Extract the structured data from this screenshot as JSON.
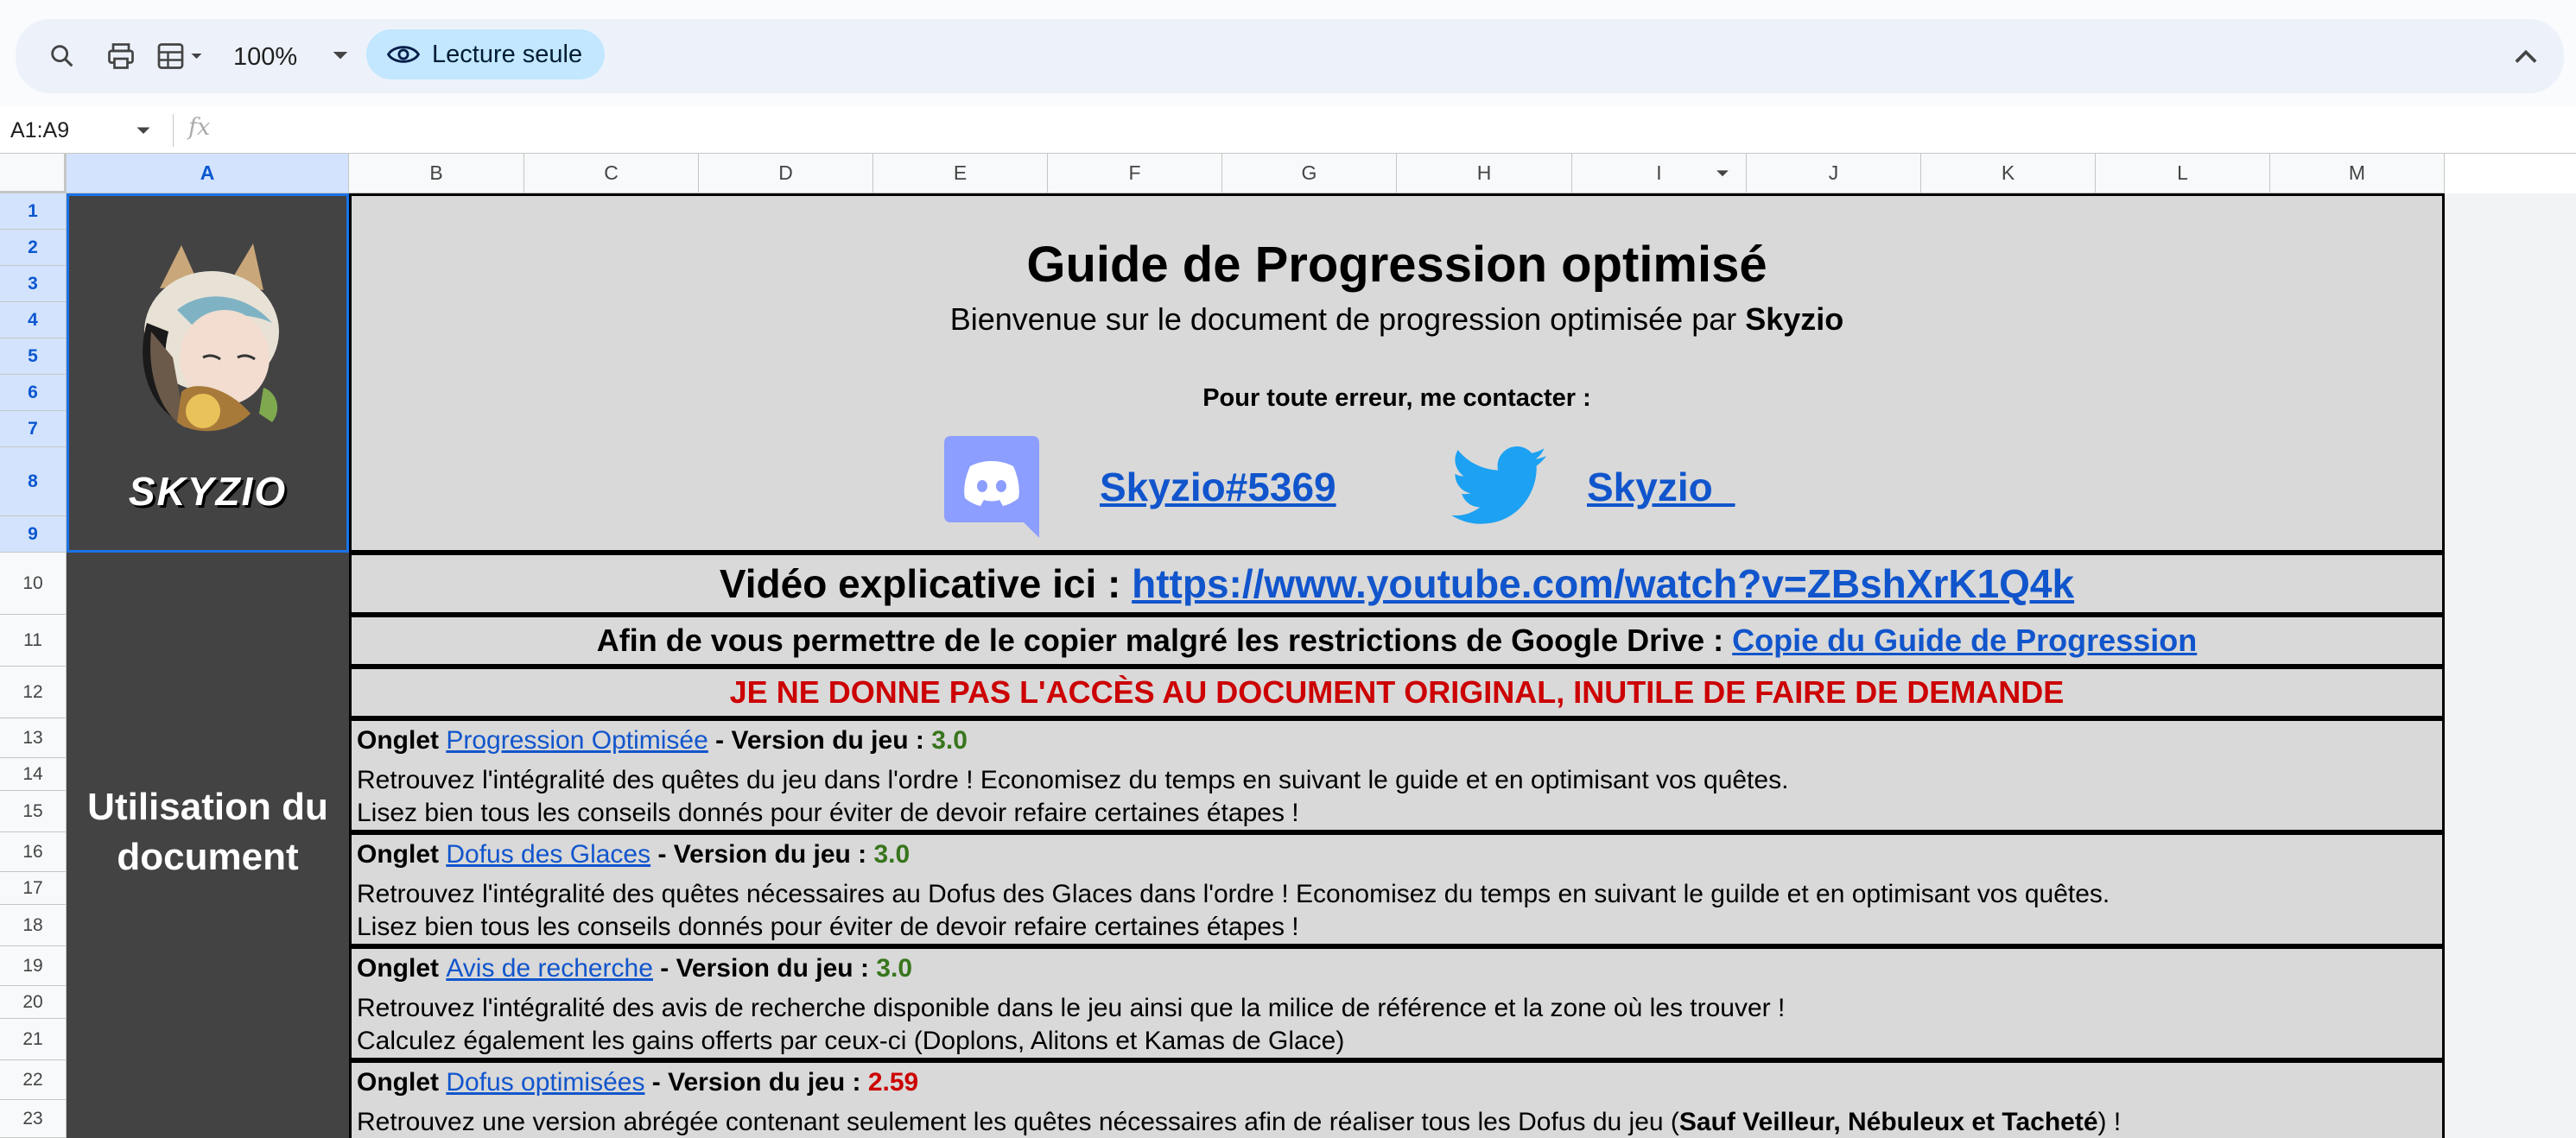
{
  "toolbar": {
    "zoom": "100%",
    "readonly_label": "Lecture seule"
  },
  "formula": {
    "namebox": "A1:A9",
    "fx": "fx"
  },
  "columns": [
    "A",
    "B",
    "C",
    "D",
    "E",
    "F",
    "G",
    "H",
    "I",
    "J",
    "K",
    "L",
    "M"
  ],
  "rows": [
    "1",
    "2",
    "3",
    "4",
    "5",
    "6",
    "7",
    "8",
    "9",
    "10",
    "11",
    "12",
    "13",
    "14",
    "15",
    "16",
    "17",
    "18",
    "19",
    "20",
    "21",
    "22",
    "23"
  ],
  "logo_text": "SKYZIO",
  "header": {
    "title": "Guide de Progression optimisé",
    "welcome_prefix": "Bienvenue sur le document de progression optimisée par ",
    "welcome_name": "Skyzio",
    "contact": "Pour toute erreur, me contacter :",
    "discord": "Skyzio#5369",
    "twitter": "Skyzio_"
  },
  "video": {
    "label": "Vidéo explicative ici : ",
    "url": "https://www.youtube.com/watch?v=ZBshXrK1Q4k"
  },
  "copy": {
    "label": "Afin de vous permettre de le copier malgré les restrictions de Google Drive : ",
    "link": "Copie du Guide de Progression"
  },
  "warning": "JE NE DONNE PAS L'ACCÈS AU DOCUMENT ORIGINAL, INUTILE DE FAIRE DE DEMANDE",
  "usage_label": "Utilisation du document",
  "sections": [
    {
      "prefix": "Onglet ",
      "link": "Progression Optimisée",
      "version_label": " - Version du jeu : ",
      "version": "3.0",
      "line1": "Retrouvez l'intégralité des quêtes du jeu dans l'ordre ! Economisez du temps en suivant le guide et en optimisant vos quêtes.",
      "line2": "Lisez bien tous les conseils donnés pour éviter de devoir refaire certaines étapes !"
    },
    {
      "prefix": "Onglet ",
      "link": "Dofus des Glaces",
      "version_label": " - Version du jeu : ",
      "version": "3.0",
      "line1": "Retrouvez l'intégralité des quêtes nécessaires au Dofus des Glaces dans l'ordre ! Economisez du temps en suivant le guilde et en optimisant vos quêtes.",
      "line2": "Lisez bien tous les conseils donnés pour éviter de devoir refaire certaines étapes !"
    },
    {
      "prefix": "Onglet ",
      "link": "Avis de recherche",
      "version_label": " - Version du jeu : ",
      "version": "3.0",
      "line1": "Retrouvez l'intégralité des avis de recherche disponible dans le jeu ainsi que la milice de référence et la zone où les trouver !",
      "line2": "Calculez également les gains offerts par ceux-ci (Doplons, Alitons et Kamas de Glace)"
    },
    {
      "prefix": "Onglet ",
      "link": "Dofus optimisées",
      "version_label": " - Version du jeu : ",
      "version": "2.59",
      "line1_prefix": "Retrouvez une version abrégée contenant seulement les quêtes nécessaires afin de réaliser tous les Dofus du jeu (",
      "line1_bold": "Sauf Veilleur, Nébuleux et Tacheté",
      "line1_suffix": ") !"
    }
  ],
  "colors": {
    "link": "#1155cc",
    "version_green": "#38761d",
    "version_red": "#cc0000",
    "cell_bg": "#d9d9d9",
    "dark_col": "#434343",
    "discord": "#7289da",
    "twitter": "#1da1f2"
  }
}
